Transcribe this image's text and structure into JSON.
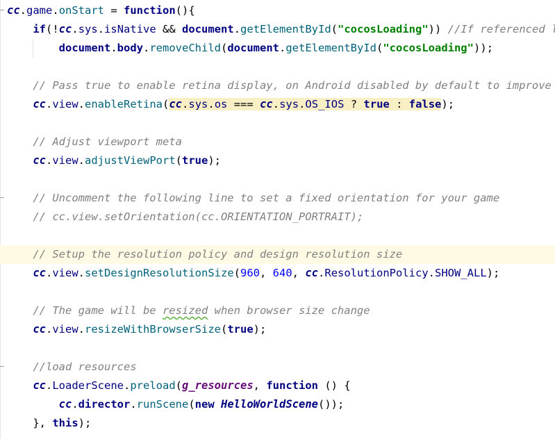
{
  "editor": {
    "lines": [
      {
        "segs": [
          {
            "t": "cc",
            "c": "obj"
          },
          {
            "t": ".",
            "c": ""
          },
          {
            "t": "game",
            "c": "prop"
          },
          {
            "t": ".",
            "c": ""
          },
          {
            "t": "onStart",
            "c": "fn"
          },
          {
            "t": " = ",
            "c": ""
          },
          {
            "t": "function",
            "c": "kw"
          },
          {
            "t": "(){",
            "c": ""
          }
        ]
      },
      {
        "segs": [
          {
            "t": "    ",
            "c": ""
          },
          {
            "t": "if",
            "c": "kw"
          },
          {
            "t": "(!",
            "c": ""
          },
          {
            "t": "cc",
            "c": "obj"
          },
          {
            "t": ".",
            "c": ""
          },
          {
            "t": "sys",
            "c": "prop"
          },
          {
            "t": ".",
            "c": ""
          },
          {
            "t": "isNative",
            "c": "prop"
          },
          {
            "t": " && ",
            "c": ""
          },
          {
            "t": "document",
            "c": "kw"
          },
          {
            "t": ".",
            "c": ""
          },
          {
            "t": "getElementById",
            "c": "fn"
          },
          {
            "t": "(",
            "c": ""
          },
          {
            "t": "\"cocosLoading\"",
            "c": "str"
          },
          {
            "t": ")) ",
            "c": ""
          },
          {
            "t": "//If referenced l",
            "c": "cmt"
          }
        ]
      },
      {
        "segs": [
          {
            "t": "        ",
            "c": ""
          },
          {
            "t": "document",
            "c": "kw"
          },
          {
            "t": ".",
            "c": ""
          },
          {
            "t": "body",
            "c": "kw"
          },
          {
            "t": ".",
            "c": ""
          },
          {
            "t": "removeChild",
            "c": "fn"
          },
          {
            "t": "(",
            "c": ""
          },
          {
            "t": "document",
            "c": "kw"
          },
          {
            "t": ".",
            "c": ""
          },
          {
            "t": "getElementById",
            "c": "fn"
          },
          {
            "t": "(",
            "c": ""
          },
          {
            "t": "\"cocosLoading\"",
            "c": "str"
          },
          {
            "t": "));",
            "c": ""
          }
        ]
      },
      {
        "segs": []
      },
      {
        "segs": [
          {
            "t": "    ",
            "c": ""
          },
          {
            "t": "// Pass true to enable retina display, on Android disabled by default to improve per",
            "c": "cmt"
          }
        ]
      },
      {
        "segs": [
          {
            "t": "    ",
            "c": ""
          },
          {
            "t": "cc",
            "c": "obj"
          },
          {
            "t": ".",
            "c": ""
          },
          {
            "t": "view",
            "c": "prop"
          },
          {
            "t": ".",
            "c": ""
          },
          {
            "t": "enableRetina",
            "c": "fn"
          },
          {
            "t": "(",
            "c": ""
          },
          {
            "t": "cc",
            "c": "obj hl"
          },
          {
            "t": ".",
            "c": "hl"
          },
          {
            "t": "sys",
            "c": "prop hl"
          },
          {
            "t": ".",
            "c": "hl"
          },
          {
            "t": "os",
            "c": "prop hl"
          },
          {
            "t": " === ",
            "c": "hl"
          },
          {
            "t": "cc",
            "c": "obj hl"
          },
          {
            "t": ".",
            "c": "hl"
          },
          {
            "t": "sys",
            "c": "prop hl"
          },
          {
            "t": ".",
            "c": "hl"
          },
          {
            "t": "OS_IOS",
            "c": "prop hl"
          },
          {
            "t": " ? ",
            "c": "hl"
          },
          {
            "t": "true",
            "c": "kw hl"
          },
          {
            "t": " : ",
            "c": "hl"
          },
          {
            "t": "false",
            "c": "kw hl"
          },
          {
            "t": ");",
            "c": ""
          }
        ]
      },
      {
        "segs": []
      },
      {
        "segs": [
          {
            "t": "    ",
            "c": ""
          },
          {
            "t": "// Adjust viewport meta",
            "c": "cmt"
          }
        ]
      },
      {
        "segs": [
          {
            "t": "    ",
            "c": ""
          },
          {
            "t": "cc",
            "c": "obj"
          },
          {
            "t": ".",
            "c": ""
          },
          {
            "t": "view",
            "c": "prop"
          },
          {
            "t": ".",
            "c": ""
          },
          {
            "t": "adjustViewPort",
            "c": "fn"
          },
          {
            "t": "(",
            "c": ""
          },
          {
            "t": "true",
            "c": "kw"
          },
          {
            "t": ");",
            "c": ""
          }
        ]
      },
      {
        "segs": []
      },
      {
        "segs": [
          {
            "t": "    ",
            "c": ""
          },
          {
            "t": "// Uncomment the following line to set a fixed orientation for your game",
            "c": "cmt"
          }
        ]
      },
      {
        "segs": [
          {
            "t": "    ",
            "c": ""
          },
          {
            "t": "// cc.view.setOrientation(cc.ORIENTATION_PORTRAIT);",
            "c": "cmt"
          }
        ]
      },
      {
        "segs": []
      },
      {
        "segs": [
          {
            "t": "    ",
            "c": ""
          },
          {
            "t": "// Setup the resolution policy and design resolution size",
            "c": "cmt"
          }
        ]
      },
      {
        "segs": [
          {
            "t": "    ",
            "c": ""
          },
          {
            "t": "cc",
            "c": "obj"
          },
          {
            "t": ".",
            "c": ""
          },
          {
            "t": "view",
            "c": "prop"
          },
          {
            "t": ".",
            "c": ""
          },
          {
            "t": "setDesignResolutionSize",
            "c": "fn"
          },
          {
            "t": "(",
            "c": ""
          },
          {
            "t": "960",
            "c": "num"
          },
          {
            "t": ", ",
            "c": ""
          },
          {
            "t": "640",
            "c": "num"
          },
          {
            "t": ", ",
            "c": ""
          },
          {
            "t": "cc",
            "c": "obj"
          },
          {
            "t": ".",
            "c": ""
          },
          {
            "t": "ResolutionPolicy",
            "c": "prop"
          },
          {
            "t": ".",
            "c": ""
          },
          {
            "t": "SHOW_ALL",
            "c": "prop"
          },
          {
            "t": ");",
            "c": ""
          }
        ]
      },
      {
        "segs": []
      },
      {
        "segs": [
          {
            "t": "    ",
            "c": ""
          },
          {
            "t": "// The game will be ",
            "c": "cmt"
          },
          {
            "t": "resized",
            "c": "cmt squig"
          },
          {
            "t": " when browser size change",
            "c": "cmt"
          }
        ]
      },
      {
        "segs": [
          {
            "t": "    ",
            "c": ""
          },
          {
            "t": "cc",
            "c": "obj"
          },
          {
            "t": ".",
            "c": ""
          },
          {
            "t": "view",
            "c": "prop"
          },
          {
            "t": ".",
            "c": ""
          },
          {
            "t": "resizeWithBrowserSize",
            "c": "fn"
          },
          {
            "t": "(",
            "c": ""
          },
          {
            "t": "true",
            "c": "kw"
          },
          {
            "t": ");",
            "c": ""
          }
        ]
      },
      {
        "segs": []
      },
      {
        "segs": [
          {
            "t": "    ",
            "c": ""
          },
          {
            "t": "//load resources",
            "c": "cmt"
          }
        ]
      },
      {
        "segs": [
          {
            "t": "    ",
            "c": ""
          },
          {
            "t": "cc",
            "c": "obj"
          },
          {
            "t": ".",
            "c": ""
          },
          {
            "t": "LoaderScene",
            "c": "prop"
          },
          {
            "t": ".",
            "c": ""
          },
          {
            "t": "preload",
            "c": "fn"
          },
          {
            "t": "(",
            "c": ""
          },
          {
            "t": "g_resources",
            "c": "ital"
          },
          {
            "t": ", ",
            "c": ""
          },
          {
            "t": "function",
            "c": "kw"
          },
          {
            "t": " () {",
            "c": ""
          }
        ]
      },
      {
        "segs": [
          {
            "t": "        ",
            "c": ""
          },
          {
            "t": "cc",
            "c": "obj"
          },
          {
            "t": ".",
            "c": ""
          },
          {
            "t": "director",
            "c": "kw"
          },
          {
            "t": ".",
            "c": ""
          },
          {
            "t": "runScene",
            "c": "fn"
          },
          {
            "t": "(",
            "c": ""
          },
          {
            "t": "new",
            "c": "kw"
          },
          {
            "t": " ",
            "c": ""
          },
          {
            "t": "HelloWorldScene",
            "c": "cls"
          },
          {
            "t": "());",
            "c": ""
          }
        ]
      },
      {
        "segs": [
          {
            "t": "    }, ",
            "c": ""
          },
          {
            "t": "this",
            "c": "kw"
          },
          {
            "t": ");",
            "c": ""
          }
        ]
      }
    ],
    "current_line_index": 13
  }
}
